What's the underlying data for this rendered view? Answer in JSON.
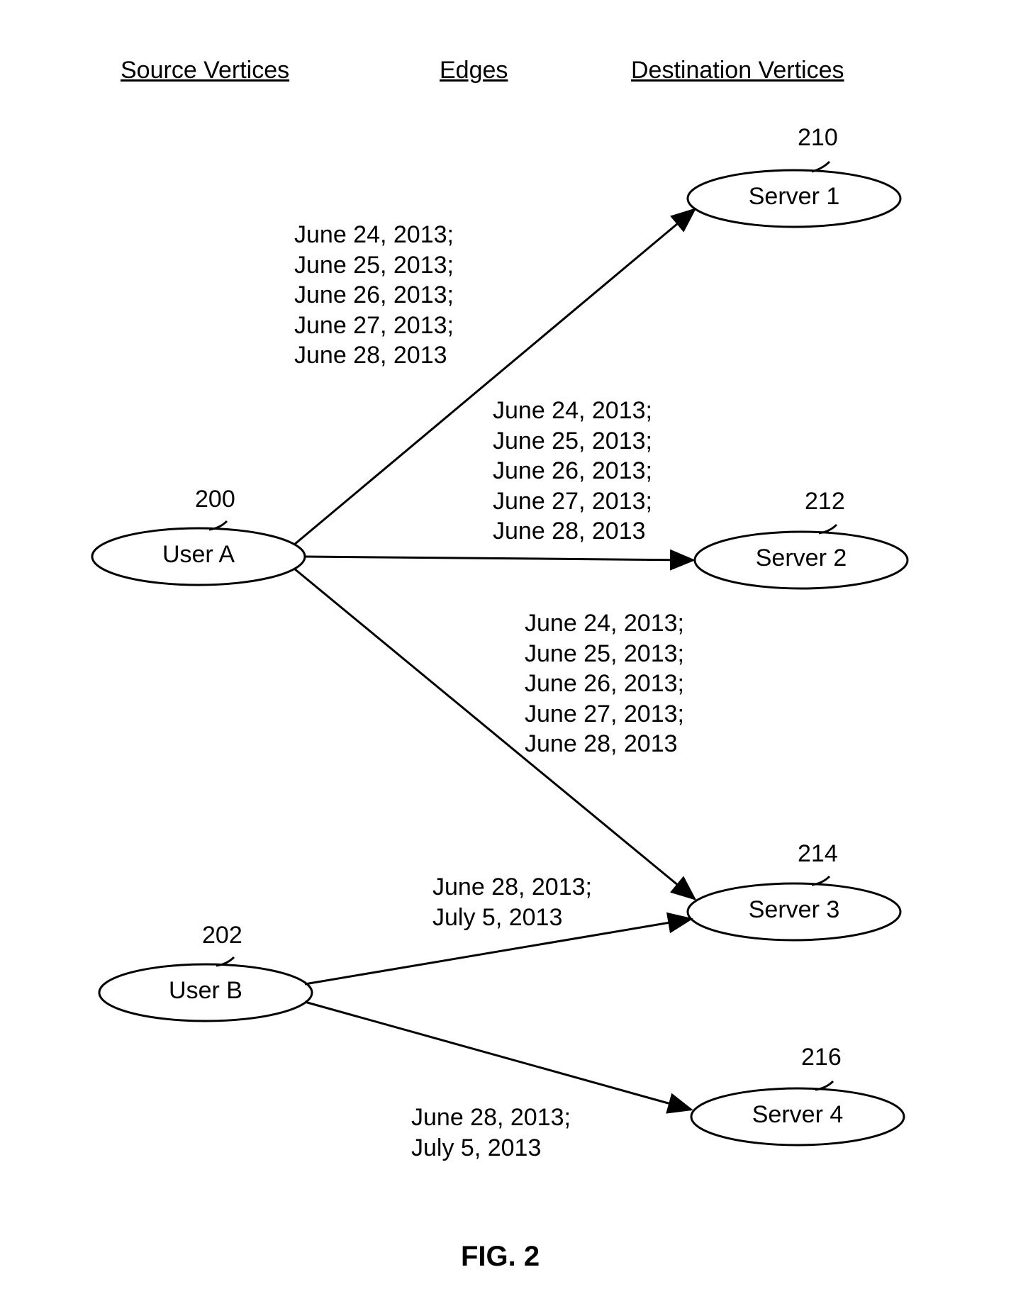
{
  "headers": {
    "source": "Source Vertices",
    "edges": "Edges",
    "dest": "Destination Vertices"
  },
  "nodes": {
    "userA": {
      "label": "User A",
      "ref": "200"
    },
    "userB": {
      "label": "User B",
      "ref": "202"
    },
    "server1": {
      "label": "Server 1",
      "ref": "210"
    },
    "server2": {
      "label": "Server 2",
      "ref": "212"
    },
    "server3": {
      "label": "Server 3",
      "ref": "214"
    },
    "server4": {
      "label": "Server 4",
      "ref": "216"
    }
  },
  "edges": {
    "a_s1": "June 24, 2013;\nJune 25, 2013;\nJune 26, 2013;\nJune 27, 2013;\nJune 28, 2013",
    "a_s2": "June 24, 2013;\nJune 25, 2013;\nJune 26, 2013;\nJune 27, 2013;\nJune 28, 2013",
    "a_s3": "June 24, 2013;\nJune 25, 2013;\nJune 26, 2013;\nJune 27, 2013;\nJune 28, 2013",
    "b_s3": "June 28, 2013;\nJuly 5, 2013",
    "b_s4": "June 28, 2013;\nJuly 5, 2013"
  },
  "figureLabel": "FIG. 2",
  "chart_data": {
    "type": "table",
    "title": "Graph: Source Vertices — Edges — Destination Vertices",
    "nodes": [
      {
        "id": "userA",
        "label": "User A",
        "ref": 200,
        "group": "source"
      },
      {
        "id": "userB",
        "label": "User B",
        "ref": 202,
        "group": "source"
      },
      {
        "id": "server1",
        "label": "Server 1",
        "ref": 210,
        "group": "destination"
      },
      {
        "id": "server2",
        "label": "Server 2",
        "ref": 212,
        "group": "destination"
      },
      {
        "id": "server3",
        "label": "Server 3",
        "ref": 214,
        "group": "destination"
      },
      {
        "id": "server4",
        "label": "Server 4",
        "ref": 216,
        "group": "destination"
      }
    ],
    "edges": [
      {
        "from": "userA",
        "to": "server1",
        "dates": [
          "June 24, 2013",
          "June 25, 2013",
          "June 26, 2013",
          "June 27, 2013",
          "June 28, 2013"
        ]
      },
      {
        "from": "userA",
        "to": "server2",
        "dates": [
          "June 24, 2013",
          "June 25, 2013",
          "June 26, 2013",
          "June 27, 2013",
          "June 28, 2013"
        ]
      },
      {
        "from": "userA",
        "to": "server3",
        "dates": [
          "June 24, 2013",
          "June 25, 2013",
          "June 26, 2013",
          "June 27, 2013",
          "June 28, 2013"
        ]
      },
      {
        "from": "userB",
        "to": "server3",
        "dates": [
          "June 28, 2013",
          "July 5, 2013"
        ]
      },
      {
        "from": "userB",
        "to": "server4",
        "dates": [
          "June 28, 2013",
          "July 5, 2013"
        ]
      }
    ]
  }
}
